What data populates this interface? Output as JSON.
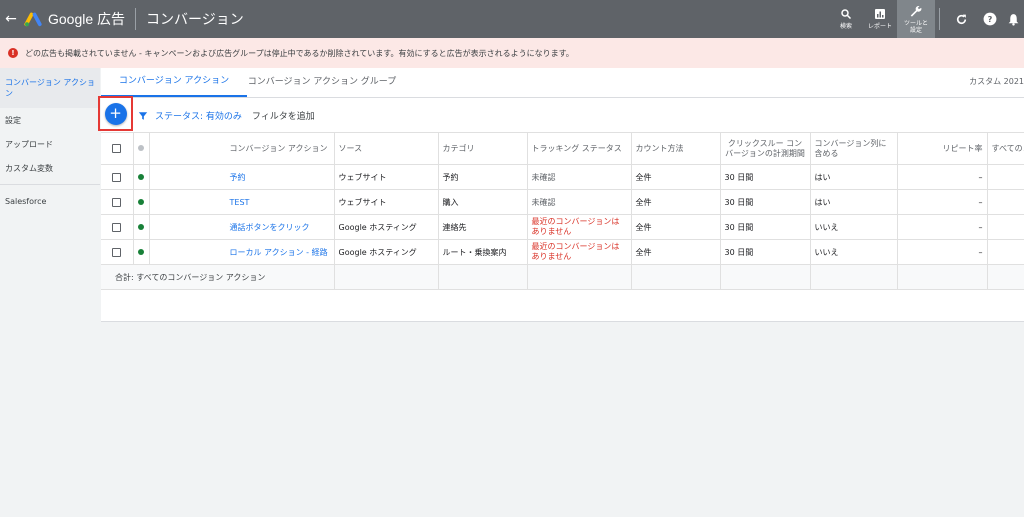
{
  "topbar": {
    "brand": "Google 広告",
    "page_title": "コンバージョン",
    "search_label": "検索",
    "report_label": "レポート",
    "tools_label": "ツールと\n設定"
  },
  "alert": {
    "text": "どの広告も掲載されていません - キャンペーンおよび広告グループは停止中であるか削除されています。有効にすると広告が表示されるようになります。"
  },
  "sidebar": {
    "items": [
      {
        "label": "コンバージョン アクション"
      },
      {
        "label": "設定"
      },
      {
        "label": "アップロード"
      },
      {
        "label": "カスタム変数"
      },
      {
        "label": "Salesforce"
      }
    ]
  },
  "tabs": {
    "active": "コンバージョン アクション",
    "second": "コンバージョン アクション グループ",
    "custom": "カスタム 2021"
  },
  "toolbar": {
    "add_label": "+",
    "status_filter": "ステータス: 有効のみ",
    "add_filter": "フィルタを追加"
  },
  "table": {
    "headers": [
      "コンバージョン アクション",
      "ソース",
      "カテゴリ",
      "トラッキング ステータス",
      "カウント方法",
      "クリックスルー コンバージョンの計測期間",
      "コンバージョン列に含める",
      "リピート率",
      "すべてのコ"
    ],
    "rows": [
      {
        "name": "予約",
        "source": "ウェブサイト",
        "category": "予約",
        "tracking": "未確認",
        "count": "全件",
        "window": "30 日間",
        "include": "はい",
        "repeat": "–",
        "all": ""
      },
      {
        "name": "TEST",
        "source": "ウェブサイト",
        "category": "購入",
        "tracking": "未確認",
        "count": "全件",
        "window": "30 日間",
        "include": "はい",
        "repeat": "–",
        "all": ""
      },
      {
        "name": "通話ボタンをクリック",
        "source": "Google ホスティング",
        "category": "連絡先",
        "tracking": "最近のコンバージョンはありません",
        "count": "全件",
        "window": "30 日間",
        "include": "いいえ",
        "repeat": "–",
        "all": ""
      },
      {
        "name": "ローカル アクション - 経路",
        "source": "Google ホスティング",
        "category": "ルート・乗換案内",
        "tracking": "最近のコンバージョンはありません",
        "count": "全件",
        "window": "30 日間",
        "include": "いいえ",
        "repeat": "–",
        "all": ""
      }
    ],
    "total_label": "合計: すべてのコンバージョン アクション"
  },
  "colors": {
    "accent": "#1a73e8",
    "topbar": "#5f6368",
    "alert_bg": "#fce8e6",
    "error": "#d93025",
    "status_green": "#188038"
  }
}
